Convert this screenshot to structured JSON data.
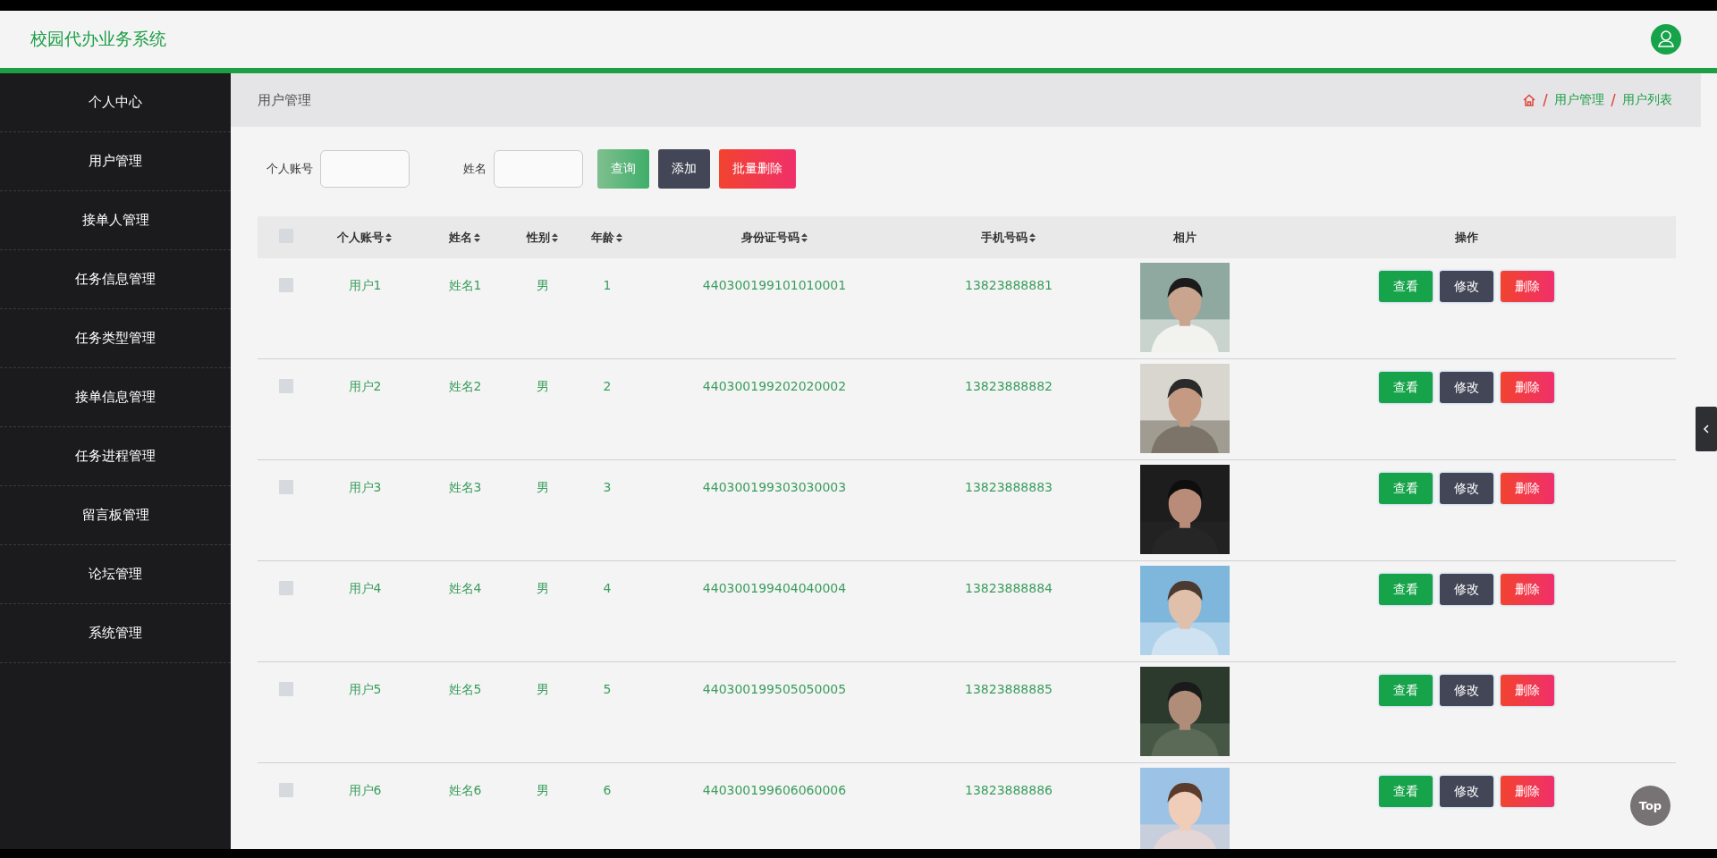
{
  "header": {
    "title": "校园代办业务系统"
  },
  "sidebar": {
    "items": [
      {
        "label": "个人中心"
      },
      {
        "label": "用户管理"
      },
      {
        "label": "接单人管理"
      },
      {
        "label": "任务信息管理"
      },
      {
        "label": "任务类型管理"
      },
      {
        "label": "接单信息管理"
      },
      {
        "label": "任务进程管理"
      },
      {
        "label": "留言板管理"
      },
      {
        "label": "论坛管理"
      },
      {
        "label": "系统管理"
      }
    ]
  },
  "breadcrumb": {
    "title": "用户管理",
    "trail": [
      "用户管理",
      "用户列表"
    ]
  },
  "search": {
    "fields": [
      {
        "label": "个人账号"
      },
      {
        "label": "姓名"
      }
    ],
    "buttons": [
      {
        "label": "查询",
        "kind": "search"
      },
      {
        "label": "添加",
        "kind": "add"
      },
      {
        "label": "批量删除",
        "kind": "delete"
      }
    ]
  },
  "table": {
    "select_all": {
      "checked": false
    },
    "columns": [
      {
        "label": "个人账号",
        "sortable": true
      },
      {
        "label": "姓名",
        "sortable": true
      },
      {
        "label": "性别",
        "sortable": true
      },
      {
        "label": "年龄",
        "sortable": true
      },
      {
        "label": "身份证号码",
        "sortable": true
      },
      {
        "label": "手机号码",
        "sortable": true
      },
      {
        "label": "相片",
        "sortable": false
      },
      {
        "label": "操作",
        "sortable": false
      }
    ],
    "rows": [
      {
        "checked": false,
        "cells": [
          "用户1",
          "姓名1",
          "男",
          "1",
          "440300199101010001",
          "13823888881"
        ],
        "actions": [
          {
            "label": "查看",
            "kind": "view"
          },
          {
            "label": "修改",
            "kind": "edit"
          },
          {
            "label": "删除",
            "kind": "delete"
          }
        ]
      },
      {
        "checked": false,
        "cells": [
          "用户2",
          "姓名2",
          "男",
          "2",
          "440300199202020002",
          "13823888882"
        ],
        "actions": [
          {
            "label": "查看",
            "kind": "view"
          },
          {
            "label": "修改",
            "kind": "edit"
          },
          {
            "label": "删除",
            "kind": "delete"
          }
        ]
      },
      {
        "checked": false,
        "cells": [
          "用户3",
          "姓名3",
          "男",
          "3",
          "440300199303030003",
          "13823888883"
        ],
        "actions": [
          {
            "label": "查看",
            "kind": "view"
          },
          {
            "label": "修改",
            "kind": "edit"
          },
          {
            "label": "删除",
            "kind": "delete"
          }
        ]
      },
      {
        "checked": false,
        "cells": [
          "用户4",
          "姓名4",
          "男",
          "4",
          "440300199404040004",
          "13823888884"
        ],
        "actions": [
          {
            "label": "查看",
            "kind": "view"
          },
          {
            "label": "修改",
            "kind": "edit"
          },
          {
            "label": "删除",
            "kind": "delete"
          }
        ]
      },
      {
        "checked": false,
        "cells": [
          "用户5",
          "姓名5",
          "男",
          "5",
          "440300199505050005",
          "13823888885"
        ],
        "actions": [
          {
            "label": "查看",
            "kind": "view"
          },
          {
            "label": "修改",
            "kind": "edit"
          },
          {
            "label": "删除",
            "kind": "delete"
          }
        ]
      },
      {
        "checked": false,
        "cells": [
          "用户6",
          "姓名6",
          "男",
          "6",
          "440300199606060006",
          "13823888886"
        ],
        "actions": [
          {
            "label": "查看",
            "kind": "view"
          },
          {
            "label": "修改",
            "kind": "edit"
          },
          {
            "label": "删除",
            "kind": "delete"
          }
        ]
      }
    ]
  },
  "top_button": {
    "label": "Top"
  }
}
